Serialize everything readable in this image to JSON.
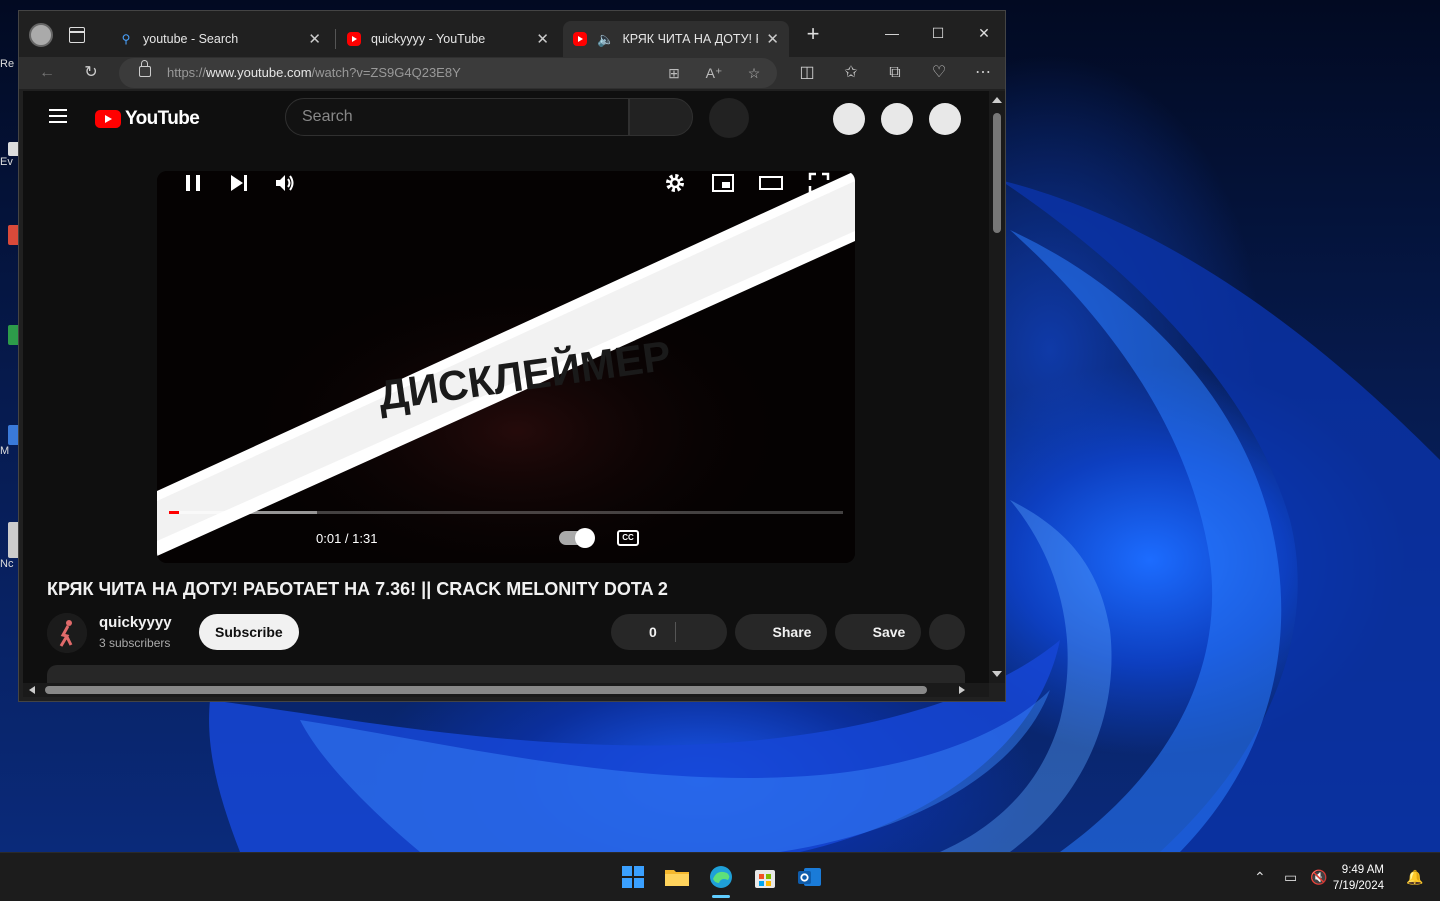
{
  "browser": {
    "tabs": [
      {
        "title": "youtube - Search",
        "icon": "search-icon"
      },
      {
        "title": "quickyyyy - YouTube",
        "icon": "youtube-favicon"
      },
      {
        "title": "КРЯК ЧИТА НА ДОТУ! РА",
        "icon": "youtube-favicon",
        "audio": "speaker-icon"
      }
    ],
    "url_scheme": "https://",
    "url_host": "www.youtube.com",
    "url_path": "/watch?v=ZS9G4Q23E8Y"
  },
  "youtube": {
    "logo_text": "YouTube",
    "search_placeholder": "Search",
    "video_overlay_text": "ДИСКЛЕЙМЕР",
    "player": {
      "time": "0:01 / 1:31",
      "played_fraction": 0.011,
      "loaded_fraction": 0.22,
      "cc_label": "CC"
    },
    "video_title": "КРЯК ЧИТА НА ДОТУ! РАБОТАЕТ НА 7.36! || CRACK MELONITY DOTA 2",
    "channel": {
      "name": "quickyyyy",
      "subscribers": "3 subscribers"
    },
    "subscribe_label": "Subscribe",
    "like_count": "0",
    "share_label": "Share",
    "save_label": "Save"
  },
  "desktop": {
    "icon_labels": [
      "Re",
      "Ev",
      "M",
      "Nc"
    ]
  },
  "taskbar": {
    "time": "9:49 AM",
    "date": "7/19/2024"
  }
}
